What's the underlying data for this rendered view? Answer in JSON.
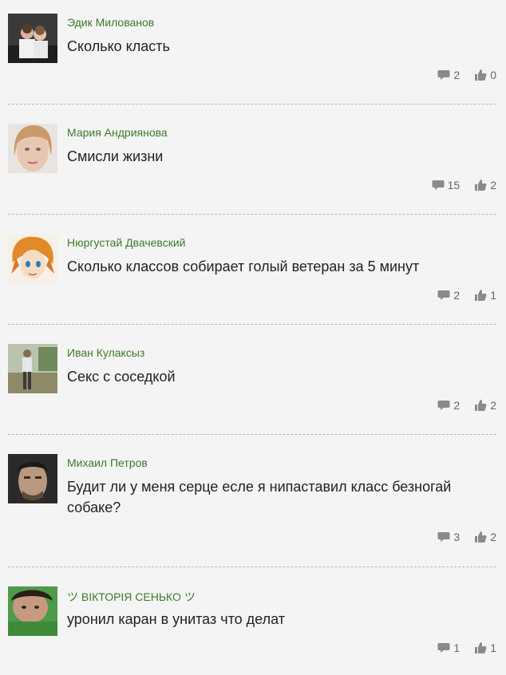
{
  "posts": [
    {
      "author": "Эдик Милованов",
      "text": "Сколько класть",
      "comments": "2",
      "likes": "0"
    },
    {
      "author": "Мария Андриянова",
      "text": "Смисли жизни",
      "comments": "15",
      "likes": "2"
    },
    {
      "author": "Нюргустай Двачевский",
      "text": "Сколько классов собирает голый ветеран за 5 минут",
      "comments": "2",
      "likes": "1"
    },
    {
      "author": "Иван Кулаксыз",
      "text": "Секс с соседкой",
      "comments": "2",
      "likes": "2"
    },
    {
      "author": "Михаил Петров",
      "text": "Будит ли у меня серце есле я нипаставил класс безногай собаке?",
      "comments": "3",
      "likes": "2"
    },
    {
      "author": "ツ ВІКТОРІЯ СЕНЬКО ツ",
      "text": "уронил каран в унитаз что делат",
      "comments": "1",
      "likes": "1"
    }
  ],
  "icons": {
    "comment": "speech-bubble-icon",
    "like": "thumbs-up-icon"
  },
  "colors": {
    "author": "#3d7a2a",
    "background": "#f4f4f4",
    "divider": "#b9b9b9"
  }
}
